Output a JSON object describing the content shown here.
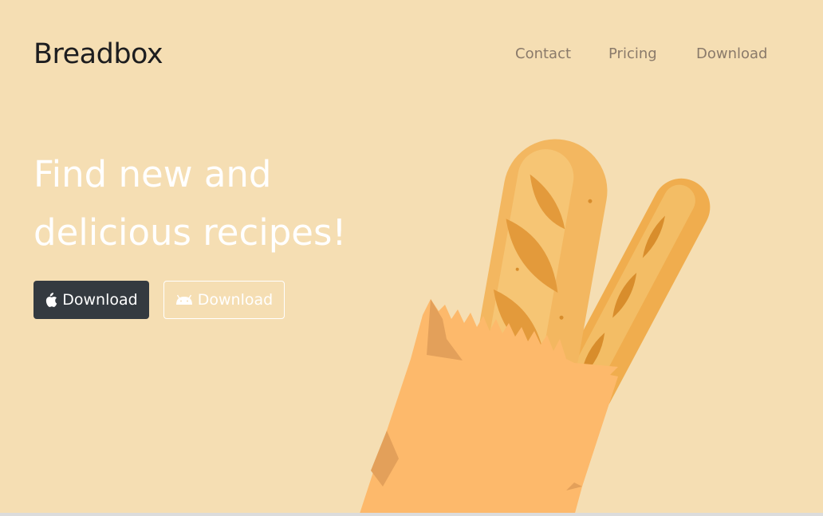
{
  "header": {
    "brand": "Breadbox",
    "nav": [
      {
        "label": "Contact"
      },
      {
        "label": "Pricing"
      },
      {
        "label": "Download"
      }
    ]
  },
  "hero": {
    "title_line1": "Find new and",
    "title_line2": "delicious recipes!",
    "buttons": [
      {
        "label": "Download",
        "icon": "apple-icon"
      },
      {
        "label": "Download",
        "icon": "android-icon"
      }
    ]
  },
  "colors": {
    "background": "#f5deb3",
    "dark_button": "#343a40",
    "hero_text": "#ffffff",
    "bag": "#fdb96b",
    "bread": "#f0b65a"
  }
}
